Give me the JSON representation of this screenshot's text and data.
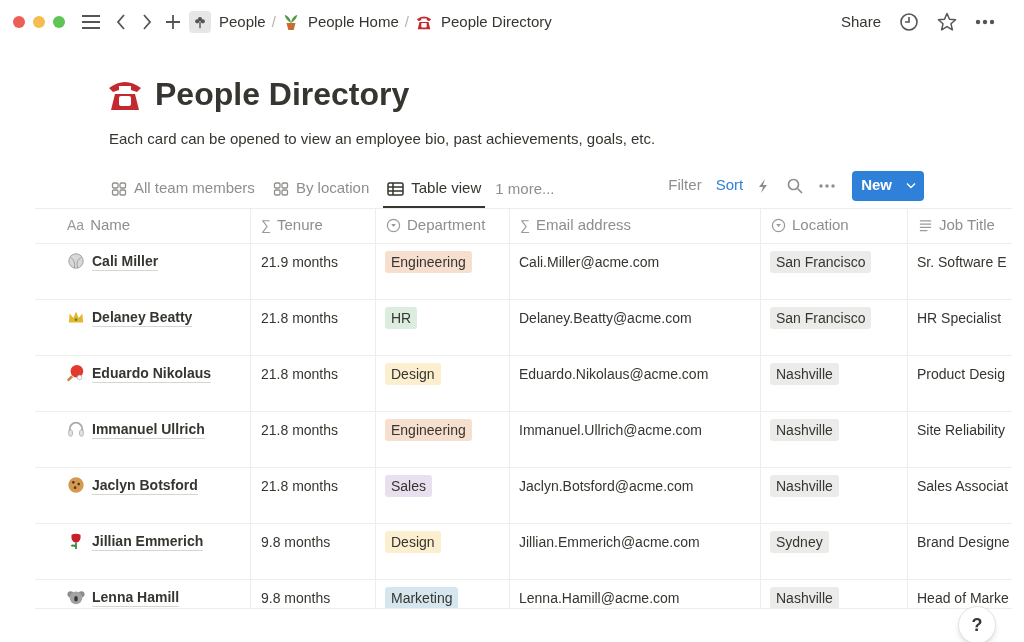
{
  "top_bar": {
    "breadcrumbs": [
      {
        "label": "People"
      },
      {
        "label": "People Home"
      },
      {
        "label": "People Directory"
      }
    ],
    "separator": "/",
    "share": "Share"
  },
  "page": {
    "title": "People Directory",
    "description": "Each card can be opened to view an employee bio, past achievements, goals, etc."
  },
  "views": [
    {
      "label": "All team members",
      "kind": "board",
      "selected": false
    },
    {
      "label": "By location",
      "kind": "board",
      "selected": false
    },
    {
      "label": "Table view",
      "kind": "table",
      "selected": true
    }
  ],
  "more_views": "1 more...",
  "toolbar": {
    "actions": [
      {
        "label": "Filter",
        "active": false
      },
      {
        "label": "Sort",
        "active": true
      }
    ],
    "new_button": "New"
  },
  "table": {
    "columns": [
      {
        "label": "Name",
        "kind": "glyph",
        "glyph": "Aa"
      },
      {
        "label": "Tenure",
        "kind": "glyph",
        "glyph": "∑"
      },
      {
        "label": "Department",
        "kind": "select"
      },
      {
        "label": "Email address",
        "kind": "glyph",
        "glyph": "∑"
      },
      {
        "label": "Location",
        "kind": "select"
      },
      {
        "label": "Job Title",
        "kind": "text"
      }
    ],
    "rows": [
      {
        "name": "Cali Miller",
        "tenure": "21.9 months",
        "department": {
          "label": "Engineering",
          "color": "#f7dfcf"
        },
        "email": "Cali.Miller@acme.com",
        "location": "San Francisco",
        "job_title": "Sr. Software E"
      },
      {
        "name": "Delaney Beatty",
        "tenure": "21.8 months",
        "department": {
          "label": "HR",
          "color": "#dcede0"
        },
        "email": "Delaney.Beatty@acme.com",
        "location": "San Francisco",
        "job_title": "HR Specialist"
      },
      {
        "name": "Eduardo Nikolaus",
        "tenure": "21.8 months",
        "department": {
          "label": "Design",
          "color": "#fbefcf"
        },
        "email": "Eduardo.Nikolaus@acme.com",
        "location": "Nashville",
        "job_title": "Product Desig"
      },
      {
        "name": "Immanuel Ullrich",
        "tenure": "21.8 months",
        "department": {
          "label": "Engineering",
          "color": "#f7dfcf"
        },
        "email": "Immanuel.Ullrich@acme.com",
        "location": "Nashville",
        "job_title": "Site Reliability"
      },
      {
        "name": "Jaclyn Botsford",
        "tenure": "21.8 months",
        "department": {
          "label": "Sales",
          "color": "#e8e0ef"
        },
        "email": "Jaclyn.Botsford@acme.com",
        "location": "Nashville",
        "job_title": "Sales Associat"
      },
      {
        "name": "Jillian Emmerich",
        "tenure": "9.8 months",
        "department": {
          "label": "Design",
          "color": "#fbefcf"
        },
        "email": "Jillian.Emmerich@acme.com",
        "location": "Sydney",
        "job_title": "Brand Designe"
      },
      {
        "name": "Lenna Hamill",
        "tenure": "9.8 months",
        "department": {
          "label": "Marketing",
          "color": "#d5e6ef"
        },
        "email": "Lenna.Hamill@acme.com",
        "location": "Nashville",
        "job_title": "Head of Marke"
      }
    ]
  },
  "help_button": "?"
}
